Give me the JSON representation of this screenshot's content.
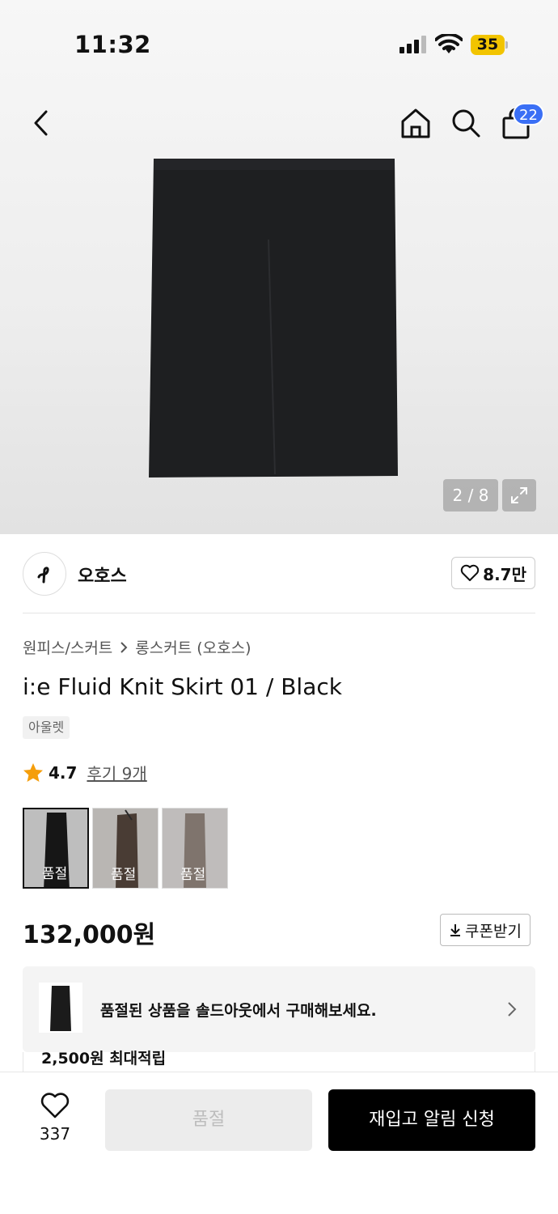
{
  "status_bar": {
    "time": "11:32",
    "battery": "35"
  },
  "header": {
    "cart_count": "22"
  },
  "gallery": {
    "counter": "2 / 8"
  },
  "brand": {
    "name": "오호스",
    "likes": "8.7만"
  },
  "breadcrumb": {
    "category": "원피스/스커트",
    "subcategory": "롱스커트 (오호스)"
  },
  "product": {
    "title": "i:e Fluid Knit Skirt 01 / Black",
    "tag": "아울렛",
    "rating": "4.7",
    "reviews": "후기 9개",
    "price": "132,000원"
  },
  "variants": [
    {
      "label": "품절",
      "color": "#1b1b1b",
      "bg": "#e8e8e8"
    },
    {
      "label": "품절",
      "color": "#5a4a40",
      "bg": "#e2dedb"
    },
    {
      "label": "품절",
      "color": "#9b8e86",
      "bg": "#e9e6e4"
    }
  ],
  "coupon": {
    "label": "쿠폰받기"
  },
  "promo": {
    "text": "품절된 상품을 솔드아웃에서 구매해보세요.",
    "reward": "2,500원 최대적립"
  },
  "bottom": {
    "wish_count": "337",
    "soldout_label": "품절",
    "restock_label": "재입고 알림 신청"
  }
}
